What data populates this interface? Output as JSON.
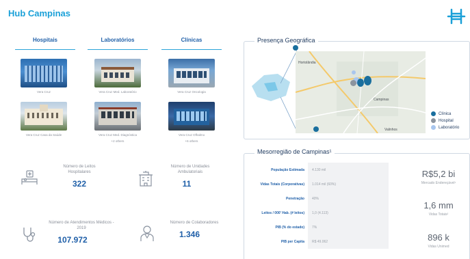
{
  "page": {
    "title": "Hub Campinas"
  },
  "columns": [
    {
      "label": "Hospitais"
    },
    {
      "label": "Laboratórios"
    },
    {
      "label": "Clínicas"
    }
  ],
  "cards": {
    "hospital_1": "Vera Cruz",
    "hospital_2": "Vera Cruz Casa da Saúde",
    "lab_1": "Vera Cruz Med. Laboratório",
    "lab_2": "Vera Cruz Med. Diagnóstica",
    "lab_2_more": "+2 others",
    "clinic_1": "Vera Cruz Oncologia",
    "clinic_2": "Vera Cruz Ofhalmo",
    "clinic_2_more": "+6 others"
  },
  "stats": [
    {
      "label": "Número de Leitos Hospitalares",
      "value": "322",
      "icon": "hospital-bed-icon"
    },
    {
      "label": "Número de Unidades Ambulatoriais",
      "value": "11",
      "icon": "building-icon"
    },
    {
      "label": "Número de Atendimentos Médicos - 2019",
      "value": "107.972",
      "icon": "stethoscope-icon"
    },
    {
      "label": "Número de Colaboradores",
      "value": "1.346",
      "icon": "doctor-icon"
    }
  ],
  "geo": {
    "title": "Presença Geográfica",
    "map_labels": {
      "a": "Hortolândia",
      "b": "Campinas",
      "c": "Valinhos"
    },
    "legend": [
      {
        "label": "Clínica",
        "color": "#1a6f9e"
      },
      {
        "label": "Hospital",
        "color": "#8c949e"
      },
      {
        "label": "Laboratório",
        "color": "#a8c6ee"
      }
    ]
  },
  "meso": {
    "title": "Mesorregião de Campinas¹",
    "rows": [
      {
        "key": "População Estimada",
        "value": "4.130 mil"
      },
      {
        "key": "Vidas Totais (Corporativas)",
        "value": "1.014 mil (60%)"
      },
      {
        "key": "Penetração",
        "value": "40%"
      },
      {
        "key": "Leitos / 000' Hab. (# leitos)",
        "value": "1,0 (4.113)"
      },
      {
        "key": "PIB (% do estado)",
        "value": "7%"
      },
      {
        "key": "PIB per Capita",
        "value": "R$ 49.062"
      }
    ],
    "highlights": [
      {
        "value": "R$5,2 bi",
        "label": "Mercado Endereçável¹"
      },
      {
        "value": "1,6 mm",
        "label": "Vidas Totais²"
      },
      {
        "value": "896 k",
        "label": "Vidas Unimed"
      }
    ]
  },
  "colors": {
    "accent": "#1aa0d8",
    "navy": "#1f5fa8"
  }
}
